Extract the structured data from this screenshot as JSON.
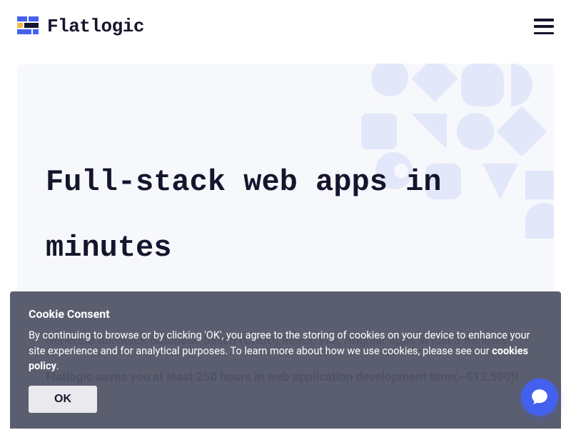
{
  "brand": {
    "name": "Flatlogic"
  },
  "hero": {
    "title": "Full-stack web apps in minutes",
    "subtitle1": "Generate full-stack database-based (CRUD) React, Vue, Angular apps in just 3 minutes!",
    "subtitle2": "Flatlogic saves you at least 250 hours in web application development time(~$12,500)!"
  },
  "cookie": {
    "title": "Cookie Consent",
    "body_pre": "By continuing to browse or by clicking 'OK', you agree to the storing of cookies on your device to enhance your site experience and for analytical purposes. To learn more about how we use cookies, please see our ",
    "link_text": "cookies policy",
    "body_post": ".",
    "ok_label": "OK"
  },
  "colors": {
    "accent": "#4361ee",
    "shape": "#d6dcf9"
  }
}
